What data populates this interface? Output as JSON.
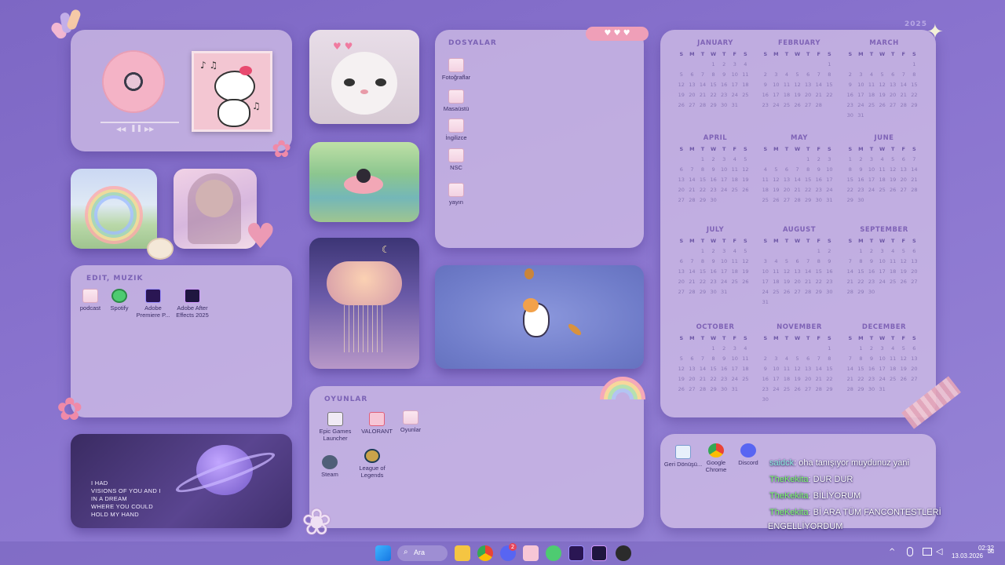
{
  "year": "2025",
  "hearts_tag": "♥ ♥ ♥",
  "music_widget": {
    "disc_label": ""
  },
  "quote": {
    "lines": [
      "I HAD",
      "VISIONS OF YOU AND I",
      "IN A DREAM",
      "WHERE YOU COULD",
      "HOLD MY HAND"
    ]
  },
  "edit_panel": {
    "title": "EDIT, MUZIK",
    "icons": [
      {
        "label": "podcast"
      },
      {
        "label": "Spotify"
      },
      {
        "label": "Adobe Premiere P..."
      },
      {
        "label": "Adobe After Effects 2025"
      }
    ]
  },
  "files_panel": {
    "title": "DOSYALAR",
    "icons": [
      {
        "label": "Fotoğraflar"
      },
      {
        "label": "Masaüstü"
      },
      {
        "label": "İngilizce"
      },
      {
        "label": "NSC"
      },
      {
        "label": "yayın"
      }
    ]
  },
  "games_panel": {
    "title": "OYUNLAR",
    "icons": [
      {
        "label": "Epic Games Launcher"
      },
      {
        "label": "VALORANT"
      },
      {
        "label": "Oyunlar"
      },
      {
        "label": "Steam"
      },
      {
        "label": "League of Legends"
      }
    ]
  },
  "apps_panel": {
    "icons": [
      {
        "label": "Geri Dönüşü..."
      },
      {
        "label": "Google Chrome"
      },
      {
        "label": "Discord"
      }
    ]
  },
  "calendar": {
    "day_headers": [
      "S",
      "M",
      "T",
      "W",
      "T",
      "F",
      "S"
    ],
    "months": [
      {
        "name": "JANUARY",
        "days": [
          "",
          "",
          "",
          "1",
          "2",
          "3",
          "4",
          "5",
          "6",
          "7",
          "8",
          "9",
          "10",
          "11",
          "12",
          "13",
          "14",
          "15",
          "16",
          "17",
          "18",
          "19",
          "20",
          "21",
          "22",
          "23",
          "24",
          "25",
          "26",
          "27",
          "28",
          "29",
          "30",
          "31"
        ]
      },
      {
        "name": "FEBRUARY",
        "days": [
          "",
          "",
          "",
          "",
          "",
          "",
          "1",
          "2",
          "3",
          "4",
          "5",
          "6",
          "7",
          "8",
          "9",
          "10",
          "11",
          "12",
          "13",
          "14",
          "15",
          "16",
          "17",
          "18",
          "19",
          "20",
          "21",
          "22",
          "23",
          "24",
          "25",
          "26",
          "27",
          "28"
        ]
      },
      {
        "name": "MARCH",
        "days": [
          "",
          "",
          "",
          "",
          "",
          "",
          "1",
          "2",
          "3",
          "4",
          "5",
          "6",
          "7",
          "8",
          "9",
          "10",
          "11",
          "12",
          "13",
          "14",
          "15",
          "16",
          "17",
          "18",
          "19",
          "20",
          "21",
          "22",
          "23",
          "24",
          "25",
          "26",
          "27",
          "28",
          "29",
          "30",
          "31"
        ]
      },
      {
        "name": "APRIL",
        "days": [
          "",
          "",
          "1",
          "2",
          "3",
          "4",
          "5",
          "6",
          "7",
          "8",
          "9",
          "10",
          "11",
          "12",
          "13",
          "14",
          "15",
          "16",
          "17",
          "18",
          "19",
          "20",
          "21",
          "22",
          "23",
          "24",
          "25",
          "26",
          "27",
          "28",
          "29",
          "30"
        ]
      },
      {
        "name": "MAY",
        "days": [
          "",
          "",
          "",
          "",
          "1",
          "2",
          "3",
          "4",
          "5",
          "6",
          "7",
          "8",
          "9",
          "10",
          "11",
          "12",
          "13",
          "14",
          "15",
          "16",
          "17",
          "18",
          "19",
          "20",
          "21",
          "22",
          "23",
          "24",
          "25",
          "26",
          "27",
          "28",
          "29",
          "30",
          "31"
        ]
      },
      {
        "name": "JUNE",
        "days": [
          "1",
          "2",
          "3",
          "4",
          "5",
          "6",
          "7",
          "8",
          "9",
          "10",
          "11",
          "12",
          "13",
          "14",
          "15",
          "16",
          "17",
          "18",
          "19",
          "20",
          "21",
          "22",
          "23",
          "24",
          "25",
          "26",
          "27",
          "28",
          "29",
          "30"
        ]
      },
      {
        "name": "JULY",
        "days": [
          "",
          "",
          "1",
          "2",
          "3",
          "4",
          "5",
          "6",
          "7",
          "8",
          "9",
          "10",
          "11",
          "12",
          "13",
          "14",
          "15",
          "16",
          "17",
          "18",
          "19",
          "20",
          "21",
          "22",
          "23",
          "24",
          "25",
          "26",
          "27",
          "28",
          "29",
          "30",
          "31"
        ]
      },
      {
        "name": "AUGUST",
        "days": [
          "",
          "",
          "",
          "",
          "",
          "1",
          "2",
          "3",
          "4",
          "5",
          "6",
          "7",
          "8",
          "9",
          "10",
          "11",
          "12",
          "13",
          "14",
          "15",
          "16",
          "17",
          "18",
          "19",
          "20",
          "21",
          "22",
          "23",
          "24",
          "25",
          "26",
          "27",
          "28",
          "29",
          "30",
          "31"
        ]
      },
      {
        "name": "SEPTEMBER",
        "days": [
          "",
          "1",
          "2",
          "3",
          "4",
          "5",
          "6",
          "7",
          "8",
          "9",
          "10",
          "11",
          "12",
          "13",
          "14",
          "15",
          "16",
          "17",
          "18",
          "19",
          "20",
          "21",
          "22",
          "23",
          "24",
          "25",
          "26",
          "27",
          "28",
          "29",
          "30"
        ]
      },
      {
        "name": "OCTOBER",
        "days": [
          "",
          "",
          "",
          "1",
          "2",
          "3",
          "4",
          "5",
          "6",
          "7",
          "8",
          "9",
          "10",
          "11",
          "12",
          "13",
          "14",
          "15",
          "16",
          "17",
          "18",
          "19",
          "20",
          "21",
          "22",
          "23",
          "24",
          "25",
          "26",
          "27",
          "28",
          "29",
          "30",
          "31"
        ]
      },
      {
        "name": "NOVEMBER",
        "days": [
          "",
          "",
          "",
          "",
          "",
          "",
          "1",
          "2",
          "3",
          "4",
          "5",
          "6",
          "7",
          "8",
          "9",
          "10",
          "11",
          "12",
          "13",
          "14",
          "15",
          "16",
          "17",
          "18",
          "19",
          "20",
          "21",
          "22",
          "23",
          "24",
          "25",
          "26",
          "27",
          "28",
          "29",
          "30"
        ]
      },
      {
        "name": "DECEMBER",
        "days": [
          "",
          "1",
          "2",
          "3",
          "4",
          "5",
          "6",
          "7",
          "8",
          "9",
          "10",
          "11",
          "12",
          "13",
          "14",
          "15",
          "16",
          "17",
          "18",
          "19",
          "20",
          "21",
          "22",
          "23",
          "24",
          "25",
          "26",
          "27",
          "28",
          "29",
          "30",
          "31"
        ]
      }
    ]
  },
  "chat": [
    {
      "user": "saidck",
      "text": ": oha tanışıyor muydunuz yani",
      "color": "#8ff0e0"
    },
    {
      "user": "TheKekita",
      "text": ": DUR DUR",
      "color": "#7dff6a"
    },
    {
      "user": "TheKekita",
      "text": ": BİLİYORUM",
      "color": "#7dff6a"
    },
    {
      "user": "TheKekita",
      "text": ": Bİ ARA TÜM FANCONTESTLERİ",
      "color": "#7dff6a"
    },
    {
      "user": "",
      "text": "ENGELLİYORDUM",
      "color": "#7dff6a"
    }
  ],
  "taskbar": {
    "search_label": "Ara",
    "discord_badge": "2",
    "time": "02:32",
    "date": "13.03.2026"
  }
}
